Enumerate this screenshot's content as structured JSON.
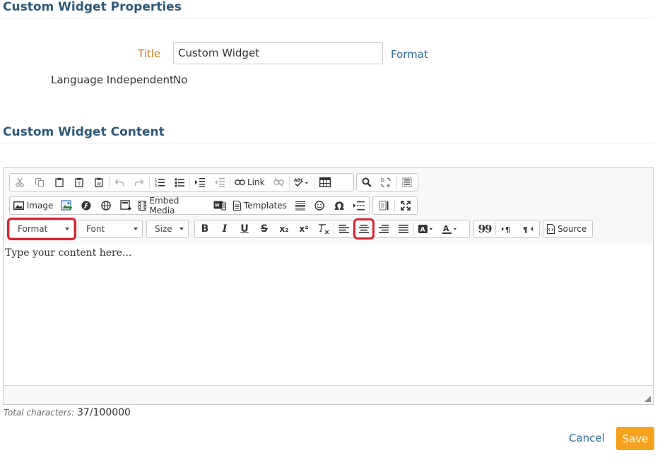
{
  "properties": {
    "heading": "Custom Widget Properties",
    "title_label": "Title",
    "title_value": "Custom Widget",
    "format_link": "Format",
    "lang_label": "Language Independent",
    "lang_value": "No"
  },
  "content": {
    "heading": "Custom Widget Content",
    "placeholder": "Type your content here..."
  },
  "toolbar": {
    "link_label": "Link",
    "image_label": "Image",
    "embed_media_label": "Embed Media",
    "templates_label": "Templates",
    "format_combo": "Format",
    "font_combo": "Font",
    "size_combo": "Size",
    "source_label": "Source",
    "bold": "B",
    "italic": "I",
    "underline": "U",
    "strike": "S",
    "subscript": "x₂",
    "superscript": "x²",
    "omega": "Ω",
    "quote": "99"
  },
  "footer": {
    "chars_label": "Total characters:",
    "chars_value": "37/100000",
    "cancel": "Cancel",
    "save": "Save"
  },
  "colors": {
    "accent": "#f6a21e",
    "heading": "#2e5a7a",
    "link": "#2e6e9e",
    "label_orange": "#c97a1a",
    "highlight": "#d9232e"
  }
}
